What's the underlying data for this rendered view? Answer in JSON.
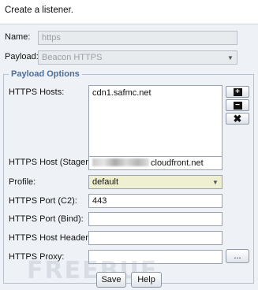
{
  "header": {
    "description": "Create a listener."
  },
  "form": {
    "name_label": "Name:",
    "name_value": "https",
    "payload_label": "Payload:",
    "payload_value": "Beacon HTTPS",
    "options_legend": "Payload Options",
    "hosts_label": "HTTPS Hosts:",
    "hosts": [
      "cdn1.safmc.net"
    ],
    "stager_label": "HTTPS Host (Stager):",
    "stager_value_suffix": "cloudfront.net",
    "profile_label": "Profile:",
    "profile_value": "default",
    "port_c2_label": "HTTPS Port (C2):",
    "port_c2_value": "443",
    "port_bind_label": "HTTPS Port (Bind):",
    "port_bind_value": "",
    "host_header_label": "HTTPS Host Header:",
    "host_header_value": "",
    "proxy_label": "HTTPS Proxy:",
    "proxy_value": "",
    "proxy_browse_label": "..."
  },
  "host_buttons": {
    "add_icon": "plus-icon",
    "remove_icon": "minus-icon",
    "clear_icon": "x-icon"
  },
  "footer": {
    "save_label": "Save",
    "help_label": "Help"
  },
  "watermark": "FREEBUF",
  "colors": {
    "legend": "#4c6d99",
    "panel_bg": "#eef1f5",
    "profile_bg": "#efefd2"
  }
}
